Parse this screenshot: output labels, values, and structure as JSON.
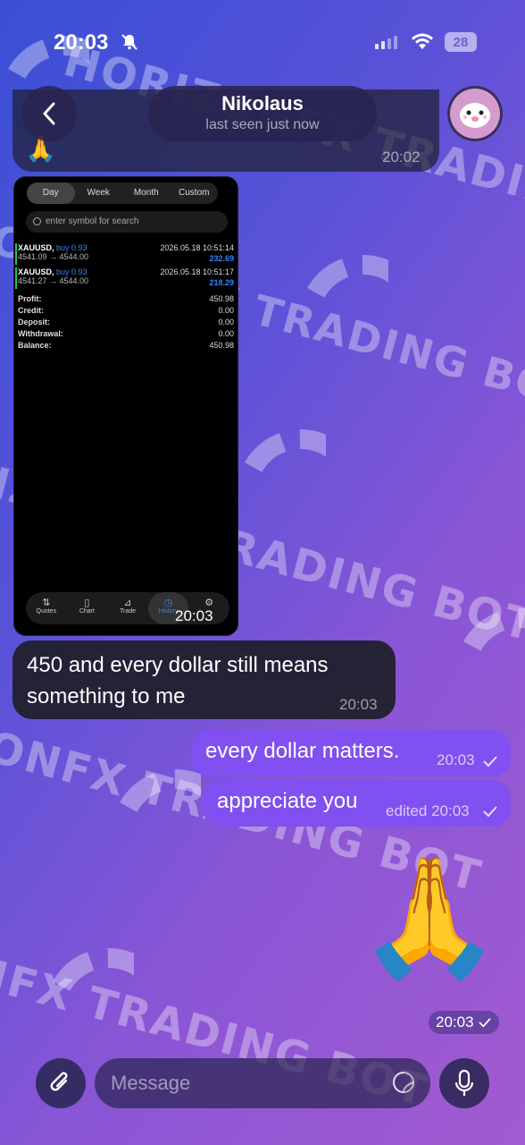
{
  "status_bar": {
    "time": "20:03",
    "battery": "28"
  },
  "header": {
    "name": "Nikolaus",
    "status": "last seen just now"
  },
  "previous_message": {
    "emoji": "🙏",
    "time": "20:02"
  },
  "screenshot": {
    "tabs": [
      "Day",
      "Week",
      "Month",
      "Custom"
    ],
    "active_tab": "Day",
    "search_placeholder": "enter symbol for search",
    "trades": [
      {
        "symbol": "XAUUSD,",
        "side": "buy 0.93",
        "date": "2026.05.18 10:51:14",
        "prices": "4541.09 → 4544.00",
        "pnl": "232.69"
      },
      {
        "symbol": "XAUUSD,",
        "side": "buy 0.93",
        "date": "2026.05.18 10:51:17",
        "prices": "4541.27 → 4544.00",
        "pnl": "218.29"
      }
    ],
    "summary": [
      {
        "label": "Profit:",
        "value": "450.98"
      },
      {
        "label": "Credit:",
        "value": "0.00"
      },
      {
        "label": "Deposit:",
        "value": "0.00"
      },
      {
        "label": "Withdrawal:",
        "value": "0.00"
      },
      {
        "label": "Balance:",
        "value": "450.98"
      }
    ],
    "nav": [
      {
        "icon": "⇅",
        "label": "Quotes"
      },
      {
        "icon": "▯",
        "label": "Chart"
      },
      {
        "icon": "⊿",
        "label": "Trade"
      },
      {
        "icon": "◷",
        "label": "History"
      },
      {
        "icon": "⚙",
        "label": ""
      }
    ],
    "time": "20:03"
  },
  "messages": {
    "incoming_1": {
      "text": "450 and every dollar still means something to me",
      "time": "20:03"
    },
    "outgoing_1": {
      "text": "every dollar matters.",
      "time": "20:03"
    },
    "outgoing_2": {
      "text": "appreciate you",
      "edited": "edited",
      "time": "20:03"
    },
    "sticker": {
      "emoji": "🙏",
      "time": "20:03"
    }
  },
  "input": {
    "placeholder": "Message"
  },
  "wallpaper": {
    "line_a": "HORIZONFX TRADING BOT",
    "line_b": "HORIZONFX TRADING BOT"
  },
  "colors": {
    "outgoing": "#8050f0",
    "incoming": "#1e1e28",
    "link": "#3b82f6",
    "profit_bar": "#22c55e"
  }
}
